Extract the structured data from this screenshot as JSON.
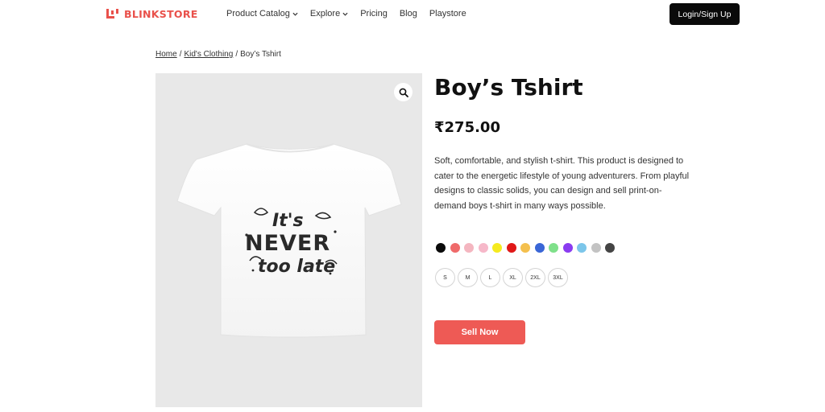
{
  "header": {
    "logo_text": "BLINKSTORE",
    "brand_color": "#e9514b",
    "nav": [
      {
        "label": "Product Catalog",
        "has_dropdown": true
      },
      {
        "label": "Explore",
        "has_dropdown": true
      },
      {
        "label": "Pricing",
        "has_dropdown": false
      },
      {
        "label": "Blog",
        "has_dropdown": false
      },
      {
        "label": "Playstore",
        "has_dropdown": false
      }
    ],
    "login_label": "Login/Sign Up"
  },
  "breadcrumb": {
    "home": "Home",
    "category": "Kid's Clothing",
    "current": "Boy’s Tshirt",
    "separator": "/"
  },
  "gallery": {
    "zoom_icon": "search-icon",
    "shirt_print": "It's NEVER too late"
  },
  "product": {
    "title": "Boy’s Tshirt",
    "price": "₹275.00",
    "description": "Soft, comfortable, and stylish t-shirt. This product is designed to cater to the energetic lifestyle of young adventurers. From playful designs to classic solids, you can design and sell print-on-demand boys t-shirt in many ways possible.",
    "colors": [
      "#0a0a0a",
      "#ef6a6a",
      "#f4b6c0",
      "#f6b8c9",
      "#f5ea1f",
      "#e01818",
      "#f4c04e",
      "#3a66d6",
      "#7fe08a",
      "#8a3cf0",
      "#7cc6ea",
      "#c3c3c3",
      "#444444"
    ],
    "sizes": [
      "S",
      "M",
      "L",
      "XL",
      "2XL",
      "3XL"
    ],
    "sell_label": "Sell Now",
    "sell_color": "#ee5a55"
  }
}
